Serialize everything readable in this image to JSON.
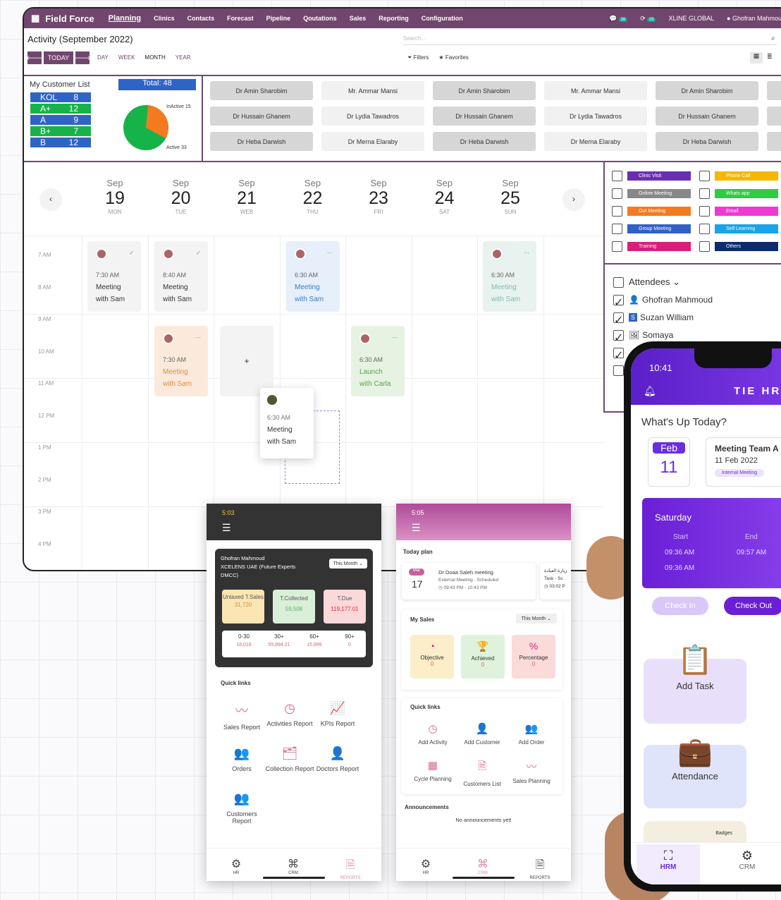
{
  "topbar": {
    "app_name": "Field Force",
    "nav": [
      "Planning",
      "Clinics",
      "Contacts",
      "Forecast",
      "Pipeline",
      "Qoutations",
      "Sales",
      "Reporting",
      "Configuration"
    ],
    "msg_count": "38",
    "activity_count": "29",
    "company": "XLINE GLOBAL",
    "user": "Ghofran Mahmoud"
  },
  "toolbar": {
    "title": "Activity (September 2022)",
    "search_placeholder": "Search...",
    "filters": "Filters",
    "favorites": "Favorites",
    "today": "TODAY",
    "views": [
      "DAY",
      "WEEK",
      "MONTH",
      "YEAR"
    ]
  },
  "customer_list": {
    "title": "My Customer List",
    "total": "Total: 48",
    "rows": [
      [
        "KOL",
        "8"
      ],
      [
        "A+",
        "12"
      ],
      [
        "A",
        "9"
      ],
      [
        "B+",
        "7"
      ],
      [
        "B",
        "12"
      ]
    ],
    "inactive": "InActive 15",
    "active": "Active 33",
    "pie": {
      "inactive": 15,
      "active": 33
    }
  },
  "doctors": [
    [
      "Dr Amin Sharobim",
      "Mr. Ammar Mansi",
      "Dr Amin Sharobim",
      "Mr. Ammar Mansi",
      "Dr Amin Sharobim"
    ],
    [
      "Dr Hussain Ghanem",
      "Dr Lydia Tawadros",
      "Dr Hussain Ghanem",
      "Dr Lydia Tawadros",
      "Dr Hussain Ghanem"
    ],
    [
      "Dr Heba Darwish",
      "Dr Merna Elaraby",
      "Dr Heba Darwish",
      "Dr Merna Elaraby",
      "Dr Heba Darwish"
    ]
  ],
  "days": [
    {
      "m": "Sep",
      "n": "19",
      "w": "MON"
    },
    {
      "m": "Sep",
      "n": "20",
      "w": "TUE"
    },
    {
      "m": "Sep",
      "n": "21",
      "w": "WEB"
    },
    {
      "m": "Sep",
      "n": "22",
      "w": "THU"
    },
    {
      "m": "Sep",
      "n": "23",
      "w": "FRI"
    },
    {
      "m": "Sep",
      "n": "24",
      "w": "SAT"
    },
    {
      "m": "Sep",
      "n": "25",
      "w": "SUN"
    }
  ],
  "hours": [
    "7 AM",
    "8 AM",
    "9 AM",
    "10 AM",
    "11 AM",
    "12 PM",
    "1 PM",
    "2 PM",
    "3 PM",
    "4 PM"
  ],
  "events": [
    {
      "time": "7:30 AM",
      "l1": "Meeting",
      "l2": "with Sam"
    },
    {
      "time": "8:40 AM",
      "l1": "Meeting",
      "l2": "with Sam"
    },
    {
      "time": "6:30 AM",
      "l1": "Meeting",
      "l2": "with Sam"
    },
    {
      "time": "6:30 AM",
      "l1": "Meeting",
      "l2": "with Sam"
    },
    {
      "time": "7:30 AM",
      "l1": "Meeting",
      "l2": "with Sam"
    },
    {
      "time": "6:30 AM",
      "l1": "Launch",
      "l2": "with Carla"
    },
    {
      "time": "6:30 AM",
      "l1": "Meeting",
      "l2": "with Sam"
    }
  ],
  "add_symbol": "+",
  "legend": [
    {
      "label": "Clinic Visit",
      "color": "#6a2fb0"
    },
    {
      "label": "Phone Call",
      "color": "#f5b800"
    },
    {
      "label": "Online Meeting",
      "color": "#888888"
    },
    {
      "label": "Whats app",
      "color": "#2ecc40"
    },
    {
      "label": "Out Meeting",
      "color": "#f47a20"
    },
    {
      "label": "Email",
      "color": "#ee3ad0"
    },
    {
      "label": "Group Meeting",
      "color": "#3160c8"
    },
    {
      "label": "Self Learning",
      "color": "#1aa3e8"
    },
    {
      "label": "Training",
      "color": "#d91e7a"
    },
    {
      "label": "Others",
      "color": "#0d2a6e"
    }
  ],
  "attendees": {
    "title": "Attendees",
    "people": [
      "Ghofran Mahmoud",
      "Suzan William",
      "Somaya"
    ],
    "tag_s": "S"
  },
  "phone1": {
    "time": "5:03",
    "user": "Ghofran Mahmoud",
    "company": "XCELENS UAE (Future Experts DMCC)",
    "period": "This Month",
    "untaxed_label": "Untaxed T.Sales",
    "untaxed": "31,720",
    "collected_label": "T.Collected",
    "collected": "59,508",
    "due_label": "T.Due",
    "due": "119,177.01",
    "aging": [
      [
        "0-30",
        "18,018"
      ],
      [
        "30+",
        "55,894.21"
      ],
      [
        "60+",
        "15,899"
      ],
      [
        "90+",
        "0"
      ]
    ],
    "quick_title": "Quick links",
    "links": [
      "Sales Report",
      "Activities Report",
      "KPIs Report",
      "Orders",
      "Collection Report",
      "Doctors Report",
      "Customers Report"
    ],
    "tabs": [
      "HR",
      "CRM",
      "REPORTS"
    ]
  },
  "phone2": {
    "time": "5:05",
    "today_plan": "Today plan",
    "month": "Mar",
    "day": "17",
    "meeting": "Dr Doaa Saleh meeting",
    "meeting_type": "External Meeting - Scheduled",
    "meeting_time": "09:43 PM - 10:43 PM",
    "task_ar": "زيارة العيادة",
    "task_line": "Task - Sc",
    "task_time": "03:02 P",
    "my_sales": "My Sales",
    "period": "This Month",
    "metrics": [
      [
        "Objective",
        "0"
      ],
      [
        "Achieved",
        "0"
      ],
      [
        "Percentage",
        "0"
      ]
    ],
    "quick_title": "Quick links",
    "links": [
      "Add Activity",
      "Add Customer",
      "Add Order",
      "Cycle Planning",
      "Customers List",
      "Sales Planning"
    ],
    "ann_title": "Announcements",
    "ann_text": "No announcements yet!",
    "tabs": [
      "HR",
      "CRM",
      "REPORTS"
    ]
  },
  "phone3": {
    "time": "10:41",
    "brand": "TIE HR",
    "question": "What's Up Today?",
    "month": "Feb",
    "day": "11",
    "meeting": "Meeting Team A",
    "date": "11 Feb 2022",
    "tag": "Internal Meeting",
    "weekday": "Saturday",
    "start_label": "Start",
    "end_label": "End",
    "start1": "09:36 AM",
    "end1": "09:57 AM",
    "start2": "09:36 AM",
    "check_in": "Check In",
    "check_out": "Check Out",
    "tiles": [
      "Add Task",
      "Attendance",
      "Badges"
    ],
    "tabs": [
      "HRM",
      "CRM"
    ]
  }
}
